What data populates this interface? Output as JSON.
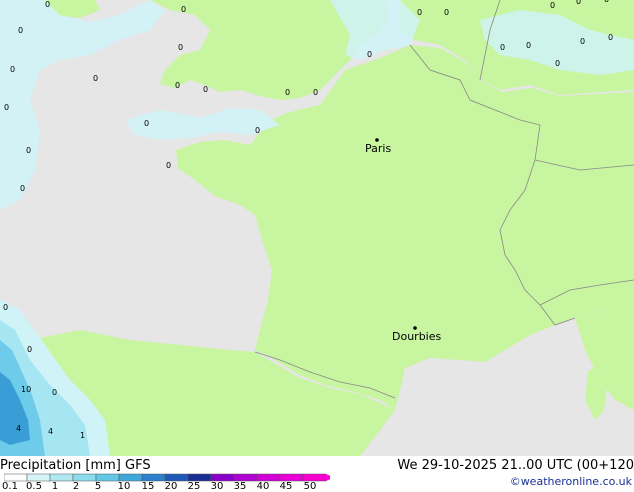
{
  "map": {
    "colors": {
      "sea": "#e6e6e6",
      "land": "#c8f5a0",
      "precip_light": "#cff3f7",
      "precip_mid": "#a6e6f2",
      "precip_heavy": "#6fcbea",
      "precip_strong": "#3a9ed6",
      "border": "#888888"
    },
    "cities": [
      {
        "name": "Paris"
      },
      {
        "name": "Dourbies"
      }
    ],
    "grid_values": [
      "0",
      "0",
      "0",
      "0",
      "0",
      "0",
      "0",
      "0",
      "0",
      "0",
      "0",
      "0",
      "0",
      "0",
      "0",
      "0",
      "0",
      "0",
      "0",
      "0",
      "0",
      "0",
      "0",
      "0",
      "0",
      "0",
      "0",
      "0",
      "0",
      "0",
      "10",
      "4",
      "4",
      "1"
    ]
  },
  "footer": {
    "title": "Precipitation [mm]  GFS",
    "datetime": "We 29-10-2025 21..00 UTC (00+120",
    "credit": "©weatheronline.co.uk",
    "legend_labels": [
      "0.1",
      "0.5",
      "1",
      "2",
      "5",
      "10",
      "15",
      "20",
      "25",
      "30",
      "35",
      "40",
      "45",
      "50"
    ],
    "legend_colors": [
      "#ffffff",
      "#d6f4f8",
      "#b0e8f2",
      "#8adbec",
      "#63c8e6",
      "#3ea8dd",
      "#2c7fcc",
      "#1f58b6",
      "#1a2f93",
      "#8a00c8",
      "#b000d2",
      "#d000d6",
      "#ea00d6",
      "#f800d0"
    ]
  }
}
